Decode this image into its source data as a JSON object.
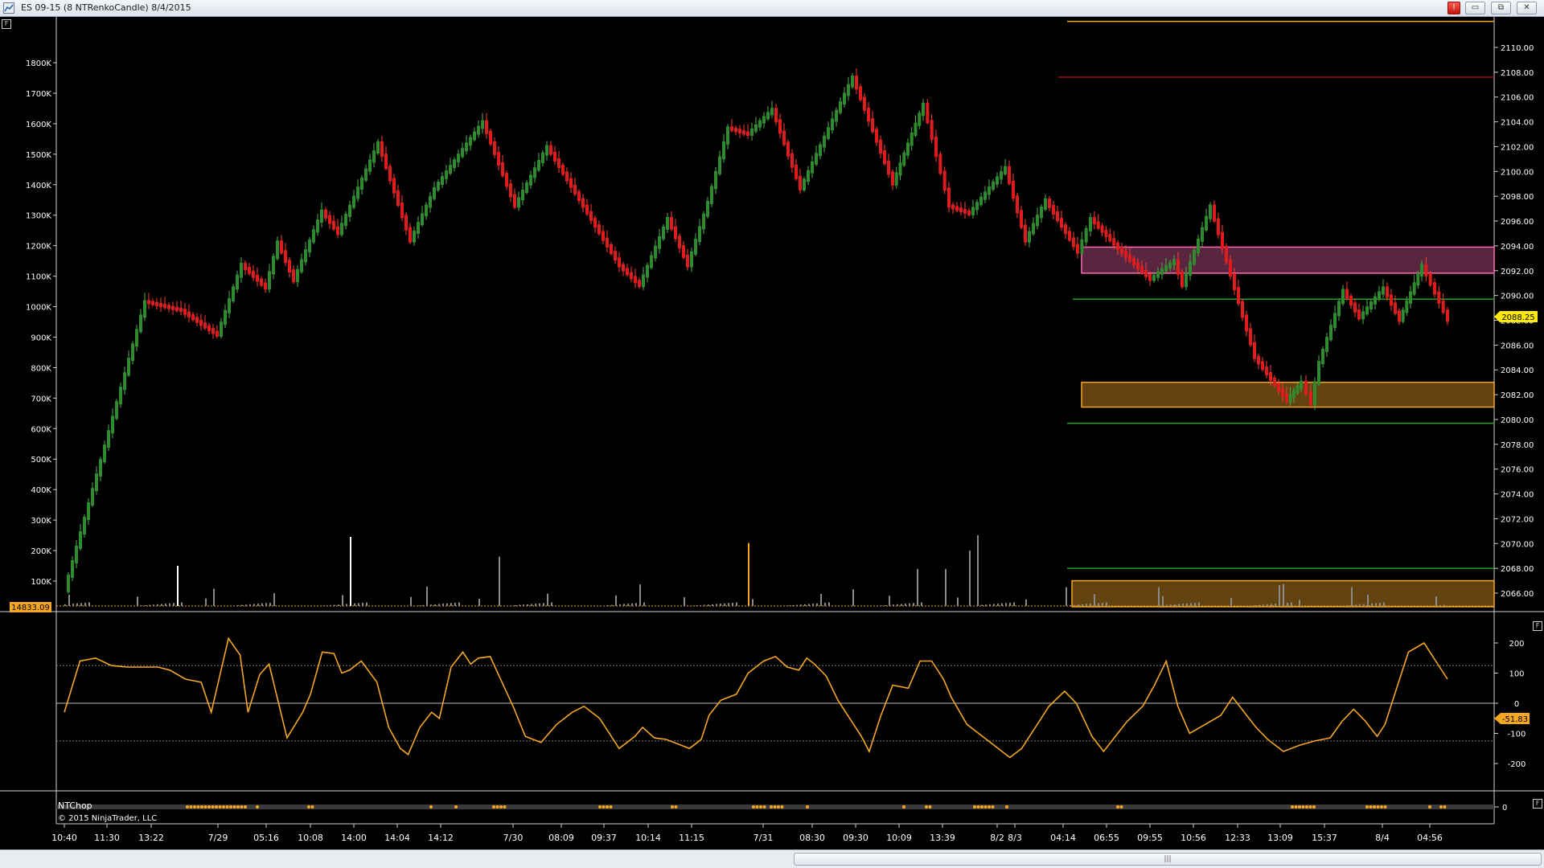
{
  "window": {
    "title": "ES 09-15 (8 NTRenkoCandle)  8/4/2015",
    "buttons": {
      "alert": "!",
      "minimize": "▭",
      "restore": "⧉",
      "close": "✕"
    }
  },
  "colors": {
    "background": "#000000",
    "up_candle": "#2e8b2e",
    "down_candle": "#e01b1b",
    "volume": "#9a9a9a",
    "accent_orange": "#f5a623",
    "pink_zone": "#ff69b4",
    "green_line": "#1f9e1f",
    "red_line": "#a01010"
  },
  "price_panel": {
    "price_axis_labels": [
      "2110.00",
      "2108.00",
      "2106.00",
      "2104.00",
      "2102.00",
      "2100.00",
      "2098.00",
      "2096.00",
      "2094.00",
      "2092.00",
      "2090.00",
      "2088.00",
      "2086.00",
      "2084.00",
      "2082.00",
      "2080.00",
      "2078.00",
      "2076.00",
      "2074.00",
      "2072.00",
      "2070.00",
      "2068.00",
      "2066.00"
    ],
    "price_axis_values": [
      2110,
      2108,
      2106,
      2104,
      2102,
      2100,
      2098,
      2096,
      2094,
      2092,
      2090,
      2088,
      2086,
      2084,
      2082,
      2080,
      2078,
      2076,
      2074,
      2072,
      2070,
      2068,
      2066
    ],
    "current_price": "2088.25",
    "volume_axis_labels": [
      "1800K",
      "1700K",
      "1600K",
      "1500K",
      "1400K",
      "1300K",
      "1200K",
      "1100K",
      "1000K",
      "900K",
      "800K",
      "700K",
      "600K",
      "500K",
      "400K",
      "300K",
      "200K",
      "100K"
    ],
    "volume_axis_values": [
      1800,
      1700,
      1600,
      1500,
      1400,
      1300,
      1200,
      1100,
      1000,
      900,
      800,
      700,
      600,
      500,
      400,
      300,
      200,
      100
    ],
    "current_volume": "14833.09",
    "zones": [
      {
        "name": "pink-zone",
        "top": 2093.9,
        "bottom": 2091.8
      },
      {
        "name": "orange-zone-upper",
        "top": 2083.0,
        "bottom": 2081.0
      },
      {
        "name": "orange-zone-lower",
        "top": 2067.0,
        "bottom": 2064.9
      }
    ],
    "levels": [
      {
        "name": "orange-top-level",
        "price": 2112.1
      },
      {
        "name": "red-level",
        "price": 2107.6
      },
      {
        "name": "green-level-1",
        "price": 2089.7
      },
      {
        "name": "green-level-2",
        "price": 2079.7
      },
      {
        "name": "green-level-3",
        "price": 2068.0
      }
    ]
  },
  "indicator_panel": {
    "axis_labels": [
      "200",
      "100",
      "0",
      "-100",
      "-200"
    ],
    "axis_values": [
      200,
      100,
      0,
      -100,
      -200
    ],
    "current_value": "-51.83"
  },
  "ntchop_panel": {
    "label": "NTChop",
    "copyright": "© 2015 NinjaTrader, LLC",
    "axis_label": "0"
  },
  "time_axis": [
    "10:40",
    "11:30",
    "13:22",
    "7/29",
    "05:16",
    "10:08",
    "14:00",
    "14:04",
    "14:12",
    "7/30",
    "08:09",
    "09:37",
    "10:14",
    "11:15",
    "7/31",
    "08:30",
    "09:30",
    "10:09",
    "13:39",
    "8/2",
    "8/3",
    "04:14",
    "06:55",
    "09:55",
    "10:56",
    "12:33",
    "13:09",
    "15:37",
    "8/4",
    "04:56"
  ],
  "panel_buttons": [
    "F",
    "F",
    "F"
  ]
}
